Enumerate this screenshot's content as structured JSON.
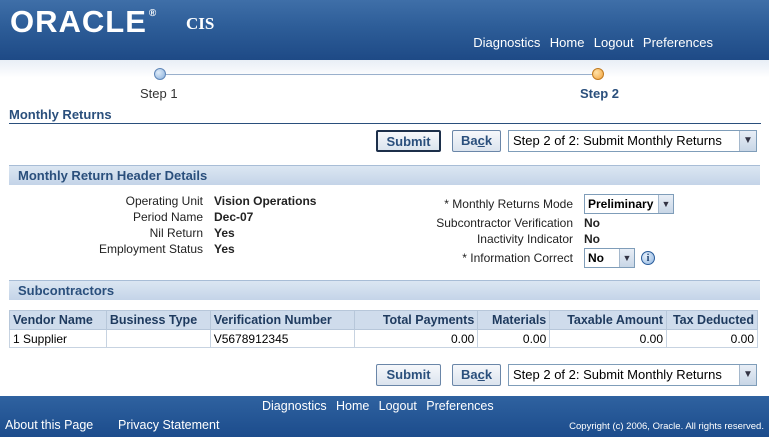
{
  "brand": {
    "logo": "ORACLE",
    "app_name": "CIS"
  },
  "global_links": [
    "Diagnostics",
    "Home",
    "Logout",
    "Preferences"
  ],
  "train": {
    "step1": "Step 1",
    "step2": "Step 2"
  },
  "page": {
    "title": "Monthly Returns"
  },
  "actions": {
    "submit": "Submit",
    "back_prefix": "Ba",
    "back_accel": "c",
    "back_suffix": "k",
    "step_select": "Step 2 of 2: Submit Monthly Returns"
  },
  "header_details": {
    "title": "Monthly Return Header Details",
    "left": [
      {
        "label": "Operating Unit",
        "value": "Vision Operations"
      },
      {
        "label": "Period Name",
        "value": "Dec-07"
      },
      {
        "label": "Nil Return",
        "value": "Yes"
      },
      {
        "label": "Employment Status",
        "value": "Yes"
      }
    ],
    "monthly_returns_mode_label": "* Monthly Returns Mode",
    "monthly_returns_mode_value": "Preliminary",
    "subcontractor_verification_label": "Subcontractor Verification",
    "subcontractor_verification_value": "No",
    "inactivity_indicator_label": "Inactivity Indicator",
    "inactivity_indicator_value": "No",
    "information_correct_label": "* Information Correct",
    "information_correct_value": "No"
  },
  "subcontractors": {
    "title": "Subcontractors",
    "columns": [
      "Vendor Name",
      "Business Type",
      "Verification Number",
      "Total Payments",
      "Materials",
      "Taxable Amount",
      "Tax Deducted"
    ],
    "rows": [
      [
        "1 Supplier",
        "",
        "V5678912345",
        "0.00",
        "0.00",
        "0.00",
        "0.00"
      ]
    ]
  },
  "footer": {
    "links": [
      "Diagnostics",
      "Home",
      "Logout",
      "Preferences"
    ],
    "about": "About this Page",
    "privacy": "Privacy Statement",
    "copyright": "Copyright (c) 2006, Oracle. All rights reserved."
  },
  "colors": {
    "header_blue": "#2d5d98",
    "accent_text": "#2a4f7c",
    "section_band": "#c4d4e8"
  }
}
